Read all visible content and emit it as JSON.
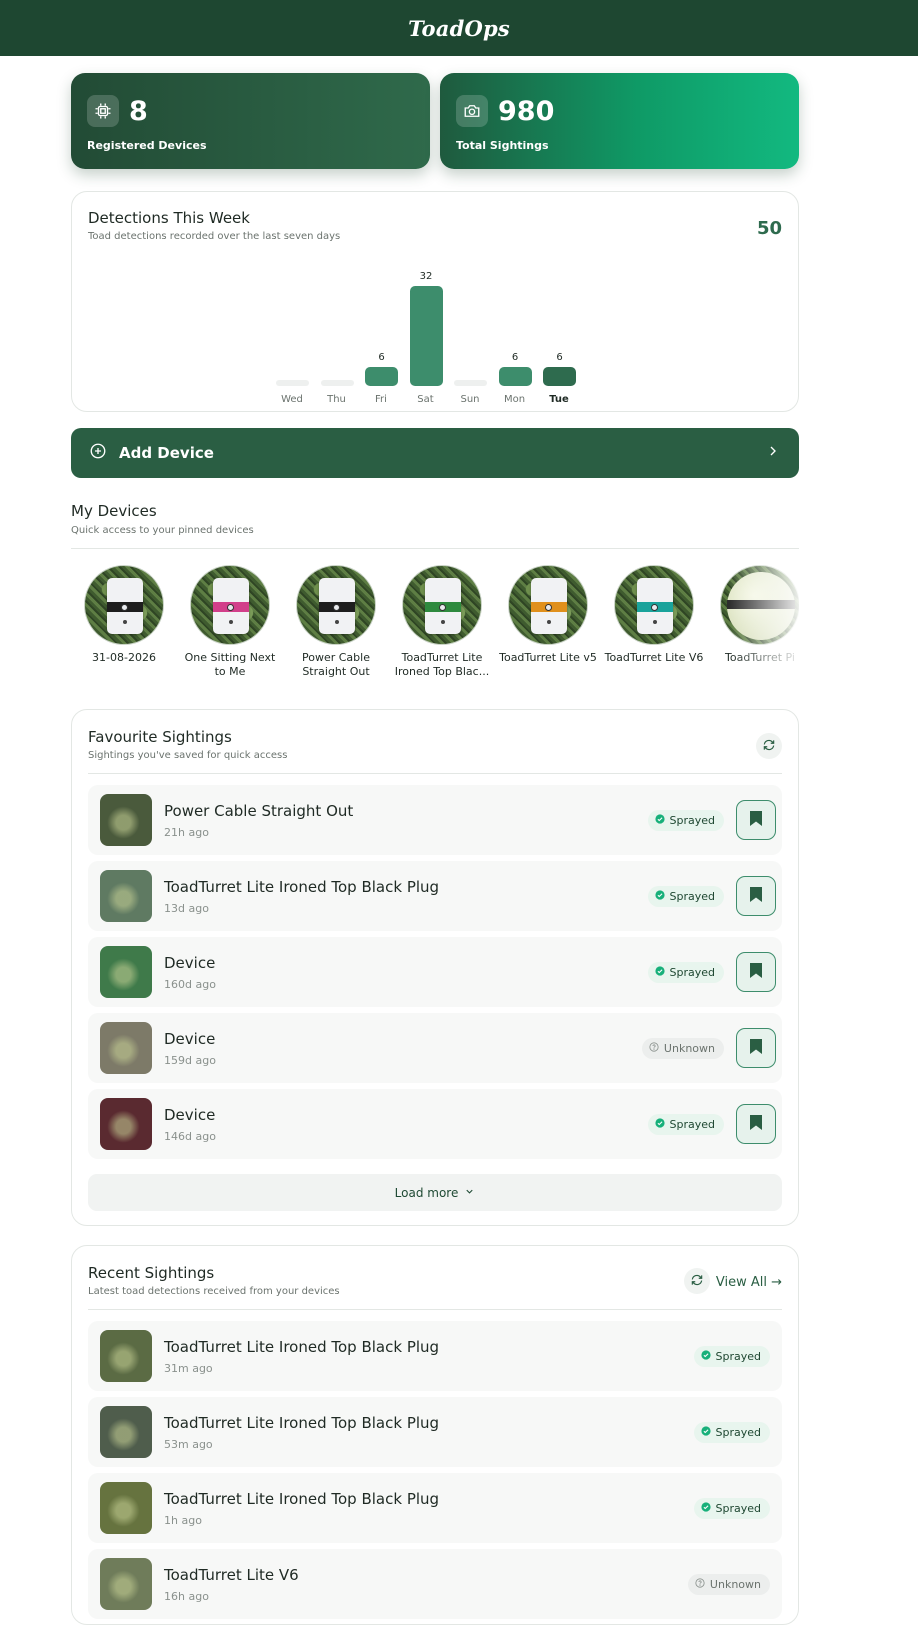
{
  "app": {
    "title": "ToadOps"
  },
  "stats": {
    "devices": {
      "value": "8",
      "label": "Registered Devices",
      "icon": "chip-icon"
    },
    "sightings": {
      "value": "980",
      "label": "Total Sightings",
      "icon": "camera-icon"
    }
  },
  "week": {
    "title": "Detections This Week",
    "subtitle": "Toad detections recorded over the last seven days",
    "total": "50",
    "today": "Tue"
  },
  "chart_data": {
    "type": "bar",
    "categories": [
      "Wed",
      "Thu",
      "Fri",
      "Sat",
      "Sun",
      "Mon",
      "Tue"
    ],
    "values": [
      0,
      0,
      6,
      32,
      0,
      6,
      6
    ],
    "value_labels": [
      "",
      "",
      "6",
      "32",
      "",
      "6",
      "6"
    ],
    "title": "Detections This Week",
    "colors": {
      "bar": "#3d8d6c",
      "today": "#2e6b4e",
      "empty": "#eef0ef"
    }
  },
  "add_device": {
    "label": "Add Device"
  },
  "my_devices": {
    "title": "My Devices",
    "subtitle": "Quick access to your pinned devices",
    "items": [
      {
        "name": "31-08-2026",
        "band": "#1e1e1e",
        "kind": "box"
      },
      {
        "name": "One Sitting Next to Me",
        "band": "#d23f8a",
        "kind": "box"
      },
      {
        "name": "Power Cable Straight Out",
        "band": "#1e1e1e",
        "kind": "box"
      },
      {
        "name": "ToadTurret Lite Ironed Top Blac...",
        "band": "#2e8a3e",
        "kind": "box"
      },
      {
        "name": "ToadTurret Lite v5",
        "band": "#e0901c",
        "kind": "box"
      },
      {
        "name": "ToadTurret Lite V6",
        "band": "#1aa39b",
        "kind": "box"
      },
      {
        "name": "ToadTurret Pi",
        "band": "#2d2d2d",
        "kind": "sphere"
      }
    ]
  },
  "favourites": {
    "title": "Favourite Sightings",
    "subtitle": "Sightings you've saved for quick access",
    "load_more": "Load more",
    "items": [
      {
        "title": "Power Cable Straight Out",
        "time": "21h ago",
        "status": "Sprayed",
        "thumb": "#4a5a3c"
      },
      {
        "title": "ToadTurret Lite Ironed Top Black Plug",
        "time": "13d ago",
        "status": "Sprayed",
        "thumb": "#5f7a62"
      },
      {
        "title": "Device",
        "time": "160d ago",
        "status": "Sprayed",
        "thumb": "#3f7a4a"
      },
      {
        "title": "Device",
        "time": "159d ago",
        "status": "Unknown",
        "thumb": "#7d7a68"
      },
      {
        "title": "Device",
        "time": "146d ago",
        "status": "Sprayed",
        "thumb": "#5a2a30"
      }
    ]
  },
  "recent": {
    "title": "Recent Sightings",
    "subtitle": "Latest toad detections received from your devices",
    "view_all": "View All →",
    "items": [
      {
        "title": "ToadTurret Lite Ironed Top Black Plug",
        "time": "31m ago",
        "status": "Sprayed",
        "thumb": "#5b6b44"
      },
      {
        "title": "ToadTurret Lite Ironed Top Black Plug",
        "time": "53m ago",
        "status": "Sprayed",
        "thumb": "#4f5d4c"
      },
      {
        "title": "ToadTurret Lite Ironed Top Black Plug",
        "time": "1h ago",
        "status": "Sprayed",
        "thumb": "#66733f"
      },
      {
        "title": "ToadTurret Lite V6",
        "time": "16h ago",
        "status": "Unknown",
        "thumb": "#6f7c5a"
      }
    ]
  },
  "colors": {
    "primary": "#1e4731",
    "accent": "#2a5e43",
    "sprayed_dot": "#17b07a"
  }
}
